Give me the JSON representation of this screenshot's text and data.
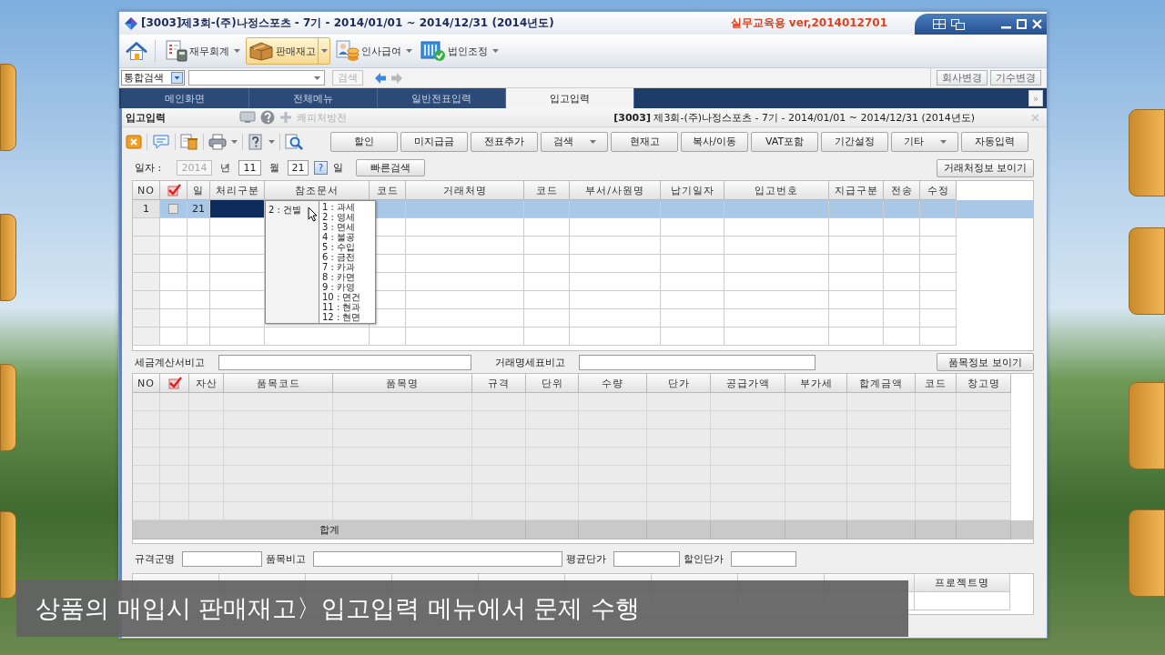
{
  "window": {
    "title": "[3003]제3회-(주)나정스포츠 - 7기 - 2014/01/01 ~ 2014/12/31 (2014년도)",
    "edition": "실무교육용 ver,2014012701"
  },
  "menu": [
    {
      "label": "재무회계",
      "selected": false
    },
    {
      "label": "판매재고",
      "selected": true
    },
    {
      "label": "인사급여",
      "selected": false
    },
    {
      "label": "법인조정",
      "selected": false
    }
  ],
  "search_bar": {
    "scope": "통합검색",
    "button": {
      "label": "검색",
      "disabled": true
    },
    "nav": [
      {
        "kind": "back",
        "disabled": false
      },
      {
        "kind": "forward",
        "disabled": true
      }
    ],
    "buttons": [
      "회사변경",
      "기수변경"
    ]
  },
  "tabs": [
    {
      "label": "메인화면",
      "selected": false
    },
    {
      "label": "전체메뉴",
      "selected": false
    },
    {
      "label": "일반전표입력",
      "selected": false
    },
    {
      "label": "입고입력",
      "selected": true
    }
  ],
  "tab_overflow": "»",
  "form": {
    "title": "입고입력",
    "link": {
      "label": "쾌피처방전",
      "disabled": true
    },
    "company": "**[3003]** 제3회-(주)나정스포츠 - 7기 - 2014/01/01 ~ 2014/12/31 (2014년도)"
  },
  "toolbar": [
    {
      "label": "할인",
      "kind": "button"
    },
    {
      "label": "미지급금",
      "kind": "button"
    },
    {
      "label": "전표추가",
      "kind": "button"
    },
    {
      "label": "검색",
      "kind": "dropdown"
    },
    {
      "label": "현재고",
      "kind": "button"
    },
    {
      "label": "복사/이동",
      "kind": "button"
    },
    {
      "label": "VAT포함",
      "kind": "button"
    },
    {
      "label": "기간설정",
      "kind": "button"
    },
    {
      "label": "기타",
      "kind": "dropdown"
    },
    {
      "label": "자동입력",
      "kind": "button"
    }
  ],
  "date_filter": {
    "label": "일자 :",
    "year": {
      "value": "2014",
      "disabled": true
    },
    "year_unit": "년",
    "month": "11",
    "month_unit": "월",
    "day": "21",
    "help": "?",
    "day_unit": "일",
    "quick_search": "빠른검색",
    "toggle": "거래처정보 보이기"
  },
  "purchase_grid": {
    "columns": [
      {
        "kind": "text",
        "label": "NO"
      },
      {
        "kind": "check"
      },
      {
        "kind": "text",
        "label": "일"
      },
      {
        "kind": "text",
        "label": "처리구분"
      },
      {
        "kind": "text",
        "label": "참조문서"
      },
      {
        "kind": "text",
        "label": "코드"
      },
      {
        "kind": "text",
        "label": "거래처명"
      },
      {
        "kind": "text",
        "label": "코드"
      },
      {
        "kind": "text",
        "label": "부서/사원명"
      },
      {
        "kind": "text",
        "label": "납기일자"
      },
      {
        "kind": "text",
        "label": "입고번호"
      },
      {
        "kind": "text",
        "label": "지급구분"
      },
      {
        "kind": "text",
        "label": "전송"
      },
      {
        "kind": "text",
        "label": "수정"
      }
    ],
    "rows": [
      {
        "no": "1",
        "checked": false,
        "day": "21",
        "selected": true
      }
    ],
    "dropdown": {
      "value": "2 : 건별",
      "options": [
        "1 : 과세",
        "2 : 영세",
        "3 : 면세",
        "4 : 불공",
        "5 : 수입",
        "6 : 금전",
        "7 : 카과",
        "8 : 카면",
        "9 : 카영",
        "10 : 면건",
        "11 : 현과",
        "12 : 현면"
      ]
    }
  },
  "memo_fields": [
    {
      "label": "세금계산서비고"
    },
    {
      "label": "거래명세표비고"
    }
  ],
  "item_info_toggle": "품목정보 보이기",
  "item_grid": {
    "columns": [
      {
        "kind": "text",
        "label": "NO"
      },
      {
        "kind": "check"
      },
      {
        "kind": "text",
        "label": "자산"
      },
      {
        "kind": "text",
        "label": "품목코드"
      },
      {
        "kind": "text",
        "label": "품목명"
      },
      {
        "kind": "text",
        "label": "규격"
      },
      {
        "kind": "text",
        "label": "단위"
      },
      {
        "kind": "text",
        "label": "수량"
      },
      {
        "kind": "text",
        "label": "단가"
      },
      {
        "kind": "text",
        "label": "공급가액"
      },
      {
        "kind": "text",
        "label": "부가세"
      },
      {
        "kind": "text",
        "label": "합계금액"
      },
      {
        "kind": "text",
        "label": "코드"
      },
      {
        "kind": "text",
        "label": "창고명"
      }
    ],
    "total_label": "합계"
  },
  "detail_fields": [
    {
      "label": "규격군명"
    },
    {
      "label": "품목비고"
    },
    {
      "label": "평균단가"
    },
    {
      "label": "할인단가"
    }
  ],
  "payment_grid": {
    "project_column": "프로젝트명"
  },
  "caption": "상품의 매입시 판매재고〉입고입력 메뉴에서 문제 수행"
}
